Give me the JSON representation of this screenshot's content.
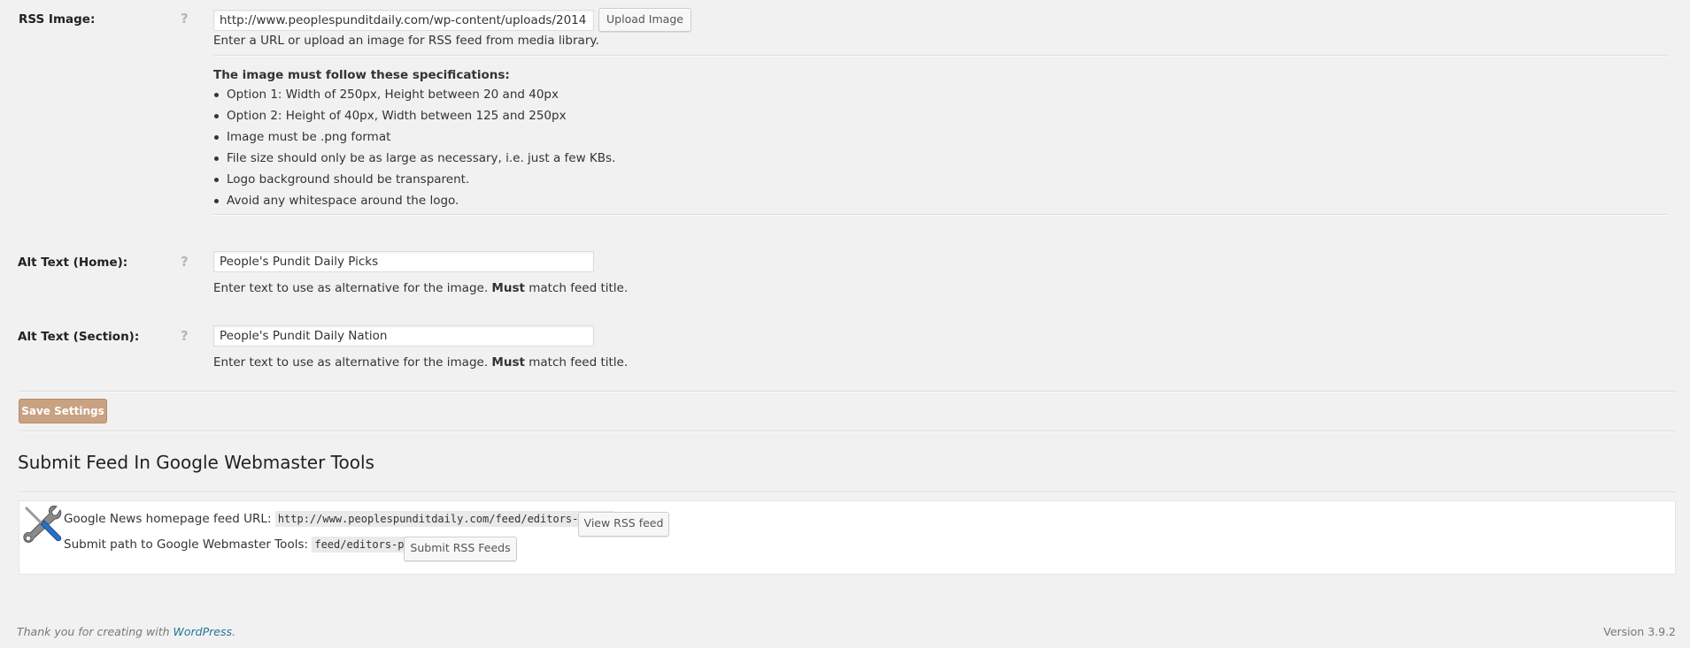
{
  "rss_image": {
    "label": "RSS Image:",
    "value": "http://www.peoplespunditdaily.com/wp-content/uploads/2014",
    "upload_button": "Upload Image",
    "description": "Enter a URL or upload an image for RSS feed from media library.",
    "spec_heading": "The image must follow these specifications:",
    "spec_items": [
      "Option 1: Width of 250px, Height between 20 and 40px",
      "Option 2: Height of 40px, Width between 125 and 250px",
      "Image must be .png format",
      "File size should only be as large as necessary, i.e. just a few KBs.",
      "Logo background should be transparent.",
      "Avoid any whitespace around the logo."
    ]
  },
  "alt_home": {
    "label": "Alt Text (Home):",
    "value": "People's Pundit Daily Picks",
    "description_pre": "Enter text to use as alternative for the image. ",
    "description_bold": "Must",
    "description_post": " match feed title."
  },
  "alt_section": {
    "label": "Alt Text (Section):",
    "value": "People's Pundit Daily Nation",
    "description_pre": "Enter text to use as alternative for the image. ",
    "description_bold": "Must",
    "description_post": " match feed title."
  },
  "help_icon": "?",
  "save_button": "Save Settings",
  "webmaster": {
    "title": "Submit Feed In Google Webmaster Tools",
    "feed_url_label": "Google News homepage feed URL:",
    "feed_url": "http://www.peoplespunditdaily.com/feed/editors-picks",
    "view_button": "View RSS feed",
    "submit_path_label": "Submit path to Google Webmaster Tools:",
    "submit_path": "feed/editors-picks",
    "submit_button": "Submit RSS Feeds"
  },
  "footer": {
    "thanks_pre": "Thank you for creating with ",
    "thanks_link": "WordPress",
    "thanks_post": ".",
    "version": "Version 3.9.2"
  }
}
